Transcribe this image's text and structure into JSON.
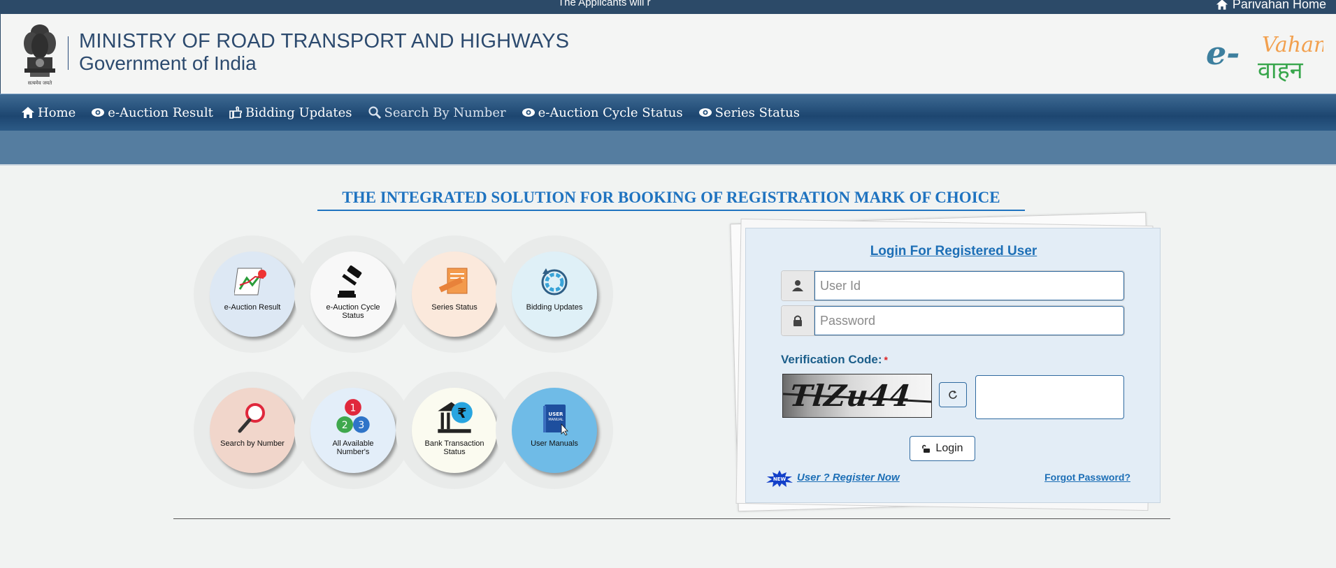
{
  "top_strip": {
    "marquee": "The Applicants will r",
    "parivahan_link": "Parivahan Home",
    "colors": {
      "background": "#2c4a68"
    }
  },
  "header": {
    "ministry": "MINISTRY OF ROAD TRANSPORT AND HIGHWAYS",
    "government": "Government of India",
    "emblem_caption": "सत्यमेव जयते",
    "logo": {
      "part1": "e-",
      "part2": "Vahan",
      "part3": "वाहन"
    }
  },
  "nav": {
    "items": [
      {
        "label": "Home",
        "icon": "home-icon"
      },
      {
        "label": "e-Auction Result",
        "icon": "eye-icon"
      },
      {
        "label": "Bidding Updates",
        "icon": "hand-point-icon"
      },
      {
        "label": "Search By Number",
        "icon": "search-icon"
      },
      {
        "label": "e-Auction Cycle Status",
        "icon": "eye-icon"
      },
      {
        "label": "Series Status",
        "icon": "eye-icon"
      }
    ],
    "active_item": "Search By Number"
  },
  "tagline": "THE INTEGRATED SOLUTION FOR BOOKING OF REGISTRATION MARK OF CHOICE",
  "tiles": [
    {
      "label": "e-Auction Result",
      "icon": "chart-icon",
      "bg": "#dde8f4"
    },
    {
      "label": "e-Auction Cycle Status",
      "icon": "gavel-icon",
      "bg": "#f8f8f8"
    },
    {
      "label": "Series Status",
      "icon": "document-icon",
      "bg": "#fbe9dc"
    },
    {
      "label": "Bidding Updates",
      "icon": "refresh-cycle-icon",
      "bg": "#dff0f7"
    },
    {
      "label": "Search by Number",
      "icon": "magnifier-icon",
      "bg": "#f1d6cb"
    },
    {
      "label": "All Available Number's",
      "icon": "numbers-icon",
      "bg": "#e3eef9"
    },
    {
      "label": "Bank Transaction Status",
      "icon": "bank-icon",
      "bg": "#fbfbf0"
    },
    {
      "label": "User Manuals",
      "icon": "manual-book-icon",
      "bg": "#6fbbe7"
    }
  ],
  "login": {
    "title": "Login For Registered User",
    "user_id_placeholder": "User Id",
    "password_placeholder": "Password",
    "verification_label": "Verification Code:",
    "required_mark": "*",
    "captcha_text": "TlZu44",
    "login_button": "Login",
    "new_badge": "NEW",
    "register_link": "User ? Register Now",
    "forgot_link": "Forgot Password?"
  }
}
